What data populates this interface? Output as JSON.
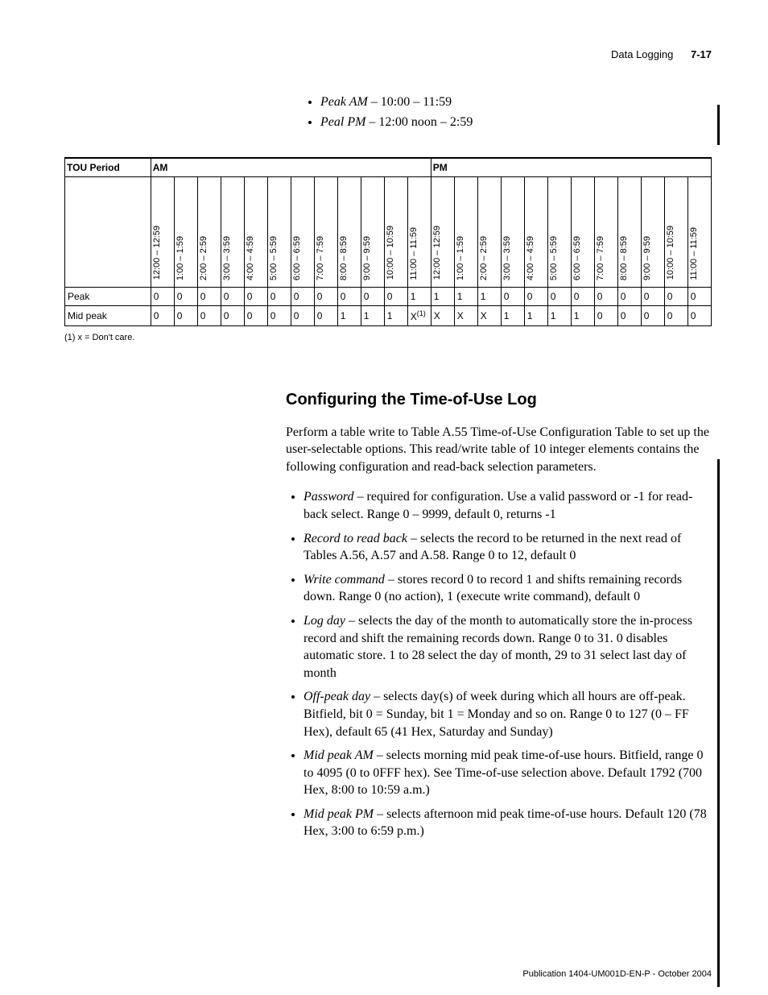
{
  "header": {
    "section": "Data Logging",
    "page": "7-17"
  },
  "top_bullets": [
    {
      "term": "Peak AM",
      "rest": " – 10:00 – 11:59"
    },
    {
      "term": "Peal PM",
      "rest": " – 12:00 noon – 2:59"
    }
  ],
  "table": {
    "tou_label": "TOU Period",
    "am_label": "AM",
    "pm_label": "PM",
    "hours": [
      "12:00 – 12:59",
      "1:00 – 1:59",
      "2:00 – 2:59",
      "3:00 – 3:59",
      "4:00 – 4:59",
      "5:00 – 5:59",
      "6:00 – 6:59",
      "7:00 – 7:59",
      "8:00 – 8:59",
      "9:00 – 9:59",
      "10:00 – 10:59",
      "11:00 – 11:59",
      "12:00 – 12:59",
      "1:00 – 1:59",
      "2:00 – 2:59",
      "3:00 – 3:59",
      "4:00 – 4:59",
      "5:00 – 5:59",
      "6:00 – 6:59",
      "7:00 – 7:59",
      "8:00 – 8:59",
      "9:00 – 9:59",
      "10:00 – 10:59",
      "11:00 – 11:59"
    ],
    "peak_label": "Peak",
    "peak": [
      "0",
      "0",
      "0",
      "0",
      "0",
      "0",
      "0",
      "0",
      "0",
      "0",
      "0",
      "1",
      "1",
      "1",
      "1",
      "0",
      "0",
      "0",
      "0",
      "0",
      "0",
      "0",
      "0",
      "0"
    ],
    "mid_label": "Mid peak",
    "mid": [
      "0",
      "0",
      "0",
      "0",
      "0",
      "0",
      "0",
      "0",
      "1",
      "1",
      "1",
      "X",
      "X",
      "X",
      "X",
      "1",
      "1",
      "1",
      "1",
      "0",
      "0",
      "0",
      "0",
      "0"
    ],
    "mid_sup_index": 11,
    "mid_sup": "(1)"
  },
  "footnote": "(1)   x = Don't care.",
  "section_title": "Configuring the Time-of-Use Log",
  "intro": "Perform a table write to Table A.55 Time-of-Use Configuration Table to set up the user-selectable options. This read/write table of 10 integer elements contains the following configuration and read-back selection parameters.",
  "params": [
    {
      "term": "Password",
      "rest": " – required for configuration. Use a valid password or -1 for read-back select. Range 0 – 9999, default 0, returns -1"
    },
    {
      "term": "Record to read back",
      "rest": " – selects the record to be returned in the next read of Tables A.56, A.57 and A.58. Range 0 to 12, default 0"
    },
    {
      "term": "Write command",
      "rest": " – stores record 0 to record 1 and shifts remaining records down. Range 0 (no action), 1 (execute write command), default 0"
    },
    {
      "term": " Log day",
      "rest": " – selects the day of the month to automatically store the in-process record and shift the remaining records down. Range 0 to 31. 0 disables automatic store. 1 to 28 select the day of month, 29 to 31 select last day of month"
    },
    {
      "term": "Off-peak day",
      "rest": " – selects day(s) of week during which all hours are off-peak. Bitfield, bit 0 = Sunday, bit 1 = Monday and so on. Range 0 to 127 (0 – FF Hex), default 65 (41 Hex, Saturday and Sunday)"
    },
    {
      "term": "Mid peak AM",
      "rest": " – selects morning mid peak time-of-use hours. Bitfield, range 0 to 4095 (0 to 0FFF hex). See Time-of-use selection above. Default 1792 (700 Hex, 8:00 to 10:59 a.m.)"
    },
    {
      "term": "Mid peak PM",
      "rest": " – selects afternoon mid peak time-of-use hours. Default 120 (78 Hex, 3:00 to 6:59 p.m.)"
    }
  ],
  "publication": "Publication 1404-UM001D-EN-P - October 2004"
}
